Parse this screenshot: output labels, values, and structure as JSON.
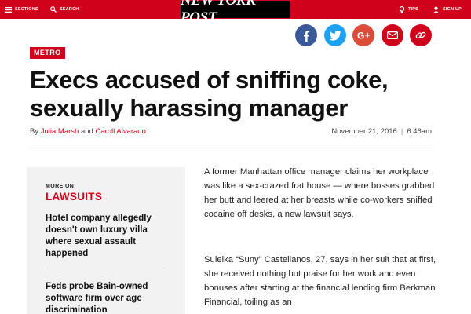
{
  "topbar": {
    "sections_label": "SECTIONS",
    "search_label": "SEARCH",
    "logo_text": "NEW YORK POST",
    "tips_label": "TIPS",
    "signup_label": "SIGN UP",
    "color": "#d0021b"
  },
  "share_icons": [
    "facebook-icon",
    "twitter-icon",
    "google-plus-icon",
    "email-icon",
    "link-icon"
  ],
  "article": {
    "section_tag": "METRO",
    "headline": "Execs accused of sniffing coke, sexually harassing manager",
    "byline_prefix": "By",
    "author_1": "Julia Marsh",
    "byline_and": "and",
    "author_2": "Caroll Alvarado",
    "date": "November 21, 2016",
    "date_separator": "|",
    "time": "6:46am",
    "paragraph_1": "A former Manhattan office manager claims her workplace was like a sex-crazed frat house — where bosses grabbed her butt and leered at her breasts while co-workers sniffed cocaine off desks, a new lawsuit says.",
    "paragraph_2": "Suleika “Suny” Castellanos, 27, says in her suit that at first, she received nothing but praise for her work and even bonuses after starting at the financial lending firm Berkman Financial, toiling as an"
  },
  "sidebar": {
    "more_on_label": "MORE ON:",
    "topic": "LAWSUITS",
    "stories": [
      "Hotel company allegedly doesn't own luxury villa where sexual assault happened",
      "Feds probe Bain-owned software firm over age discrimination"
    ]
  }
}
